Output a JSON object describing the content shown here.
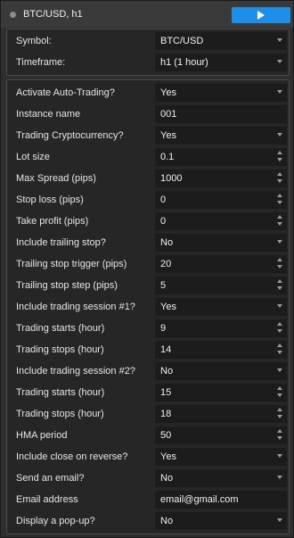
{
  "window": {
    "title": "BTC/USD, h1",
    "play_icon": "play-icon",
    "colors": {
      "accent": "#1e8fe8",
      "background": "#2e2e2e",
      "field": "#1c1c1c"
    }
  },
  "symbol_panel": {
    "rows": [
      {
        "label": "Symbol:",
        "value": "BTC/USD",
        "control": "dropdown"
      },
      {
        "label": "Timeframe:",
        "value": "h1 (1 hour)",
        "control": "dropdown"
      }
    ]
  },
  "params": {
    "rows": [
      {
        "label": "Activate Auto-Trading?",
        "value": "Yes",
        "control": "dropdown"
      },
      {
        "label": "Instance name",
        "value": "001",
        "control": "text"
      },
      {
        "label": "Trading Cryptocurrency?",
        "value": "Yes",
        "control": "dropdown"
      },
      {
        "label": "Lot size",
        "value": "0.1",
        "control": "spinner"
      },
      {
        "label": "Max Spread (pips)",
        "value": "1000",
        "control": "spinner"
      },
      {
        "label": "Stop loss (pips)",
        "value": "0",
        "control": "spinner"
      },
      {
        "label": "Take profit (pips)",
        "value": "0",
        "control": "spinner"
      },
      {
        "label": "Include trailing stop?",
        "value": "No",
        "control": "dropdown"
      },
      {
        "label": "Trailing stop trigger (pips)",
        "value": "20",
        "control": "spinner"
      },
      {
        "label": "Trailing stop step (pips)",
        "value": "5",
        "control": "spinner"
      },
      {
        "label": "Include trading session #1?",
        "value": "Yes",
        "control": "dropdown"
      },
      {
        "label": "Trading starts (hour)",
        "value": "9",
        "control": "spinner"
      },
      {
        "label": "Trading stops (hour)",
        "value": "14",
        "control": "spinner"
      },
      {
        "label": "Include trading session #2?",
        "value": "No",
        "control": "dropdown"
      },
      {
        "label": "Trading starts (hour)",
        "value": "15",
        "control": "spinner"
      },
      {
        "label": "Trading stops (hour)",
        "value": "18",
        "control": "spinner"
      },
      {
        "label": "HMA period",
        "value": "50",
        "control": "spinner"
      },
      {
        "label": "Include close on reverse?",
        "value": "Yes",
        "control": "dropdown"
      },
      {
        "label": "Send an email?",
        "value": "No",
        "control": "dropdown"
      },
      {
        "label": "Email address",
        "value": "email@gmail.com",
        "control": "text"
      },
      {
        "label": "Display a pop-up?",
        "value": "No",
        "control": "dropdown"
      }
    ]
  }
}
